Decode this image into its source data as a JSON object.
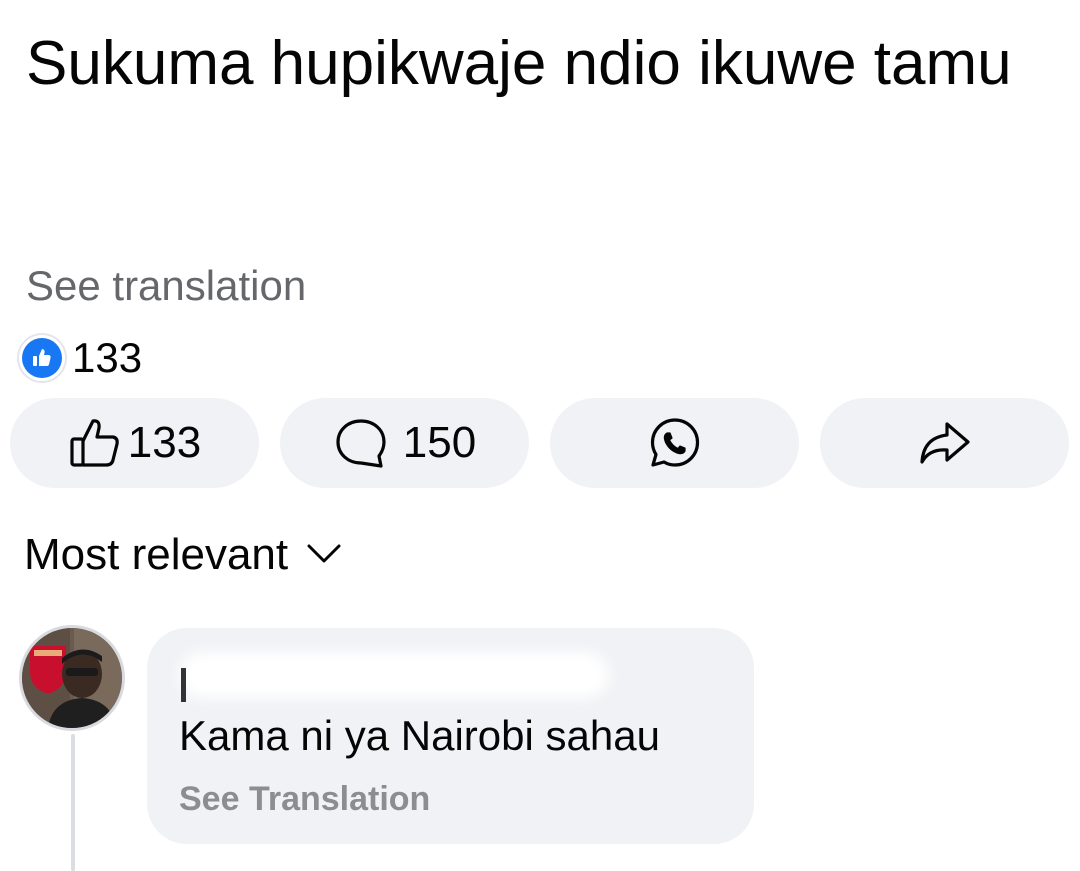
{
  "post": {
    "text": "Sukuma hupikwaje ndio ikuwe tamu",
    "see_translation_label": "See translation"
  },
  "reactions": {
    "icon": "like-icon",
    "count": "133"
  },
  "actions": {
    "like": {
      "icon": "thumbs-up-outline-icon",
      "count": "133"
    },
    "comment": {
      "icon": "comment-bubble-icon",
      "count": "150"
    },
    "whatsapp": {
      "icon": "whatsapp-icon"
    },
    "share": {
      "icon": "share-arrow-icon"
    }
  },
  "comments_sort": {
    "label": "Most relevant",
    "icon": "chevron-down-icon"
  },
  "comment": {
    "avatar_icon": "profile-avatar",
    "text": "Kama ni ya Nairobi sahau",
    "see_translation_label": "See Translation"
  },
  "colors": {
    "brand_blue": "#1877f2",
    "pill_background": "#f0f2f5",
    "secondary_text": "#65676b"
  }
}
